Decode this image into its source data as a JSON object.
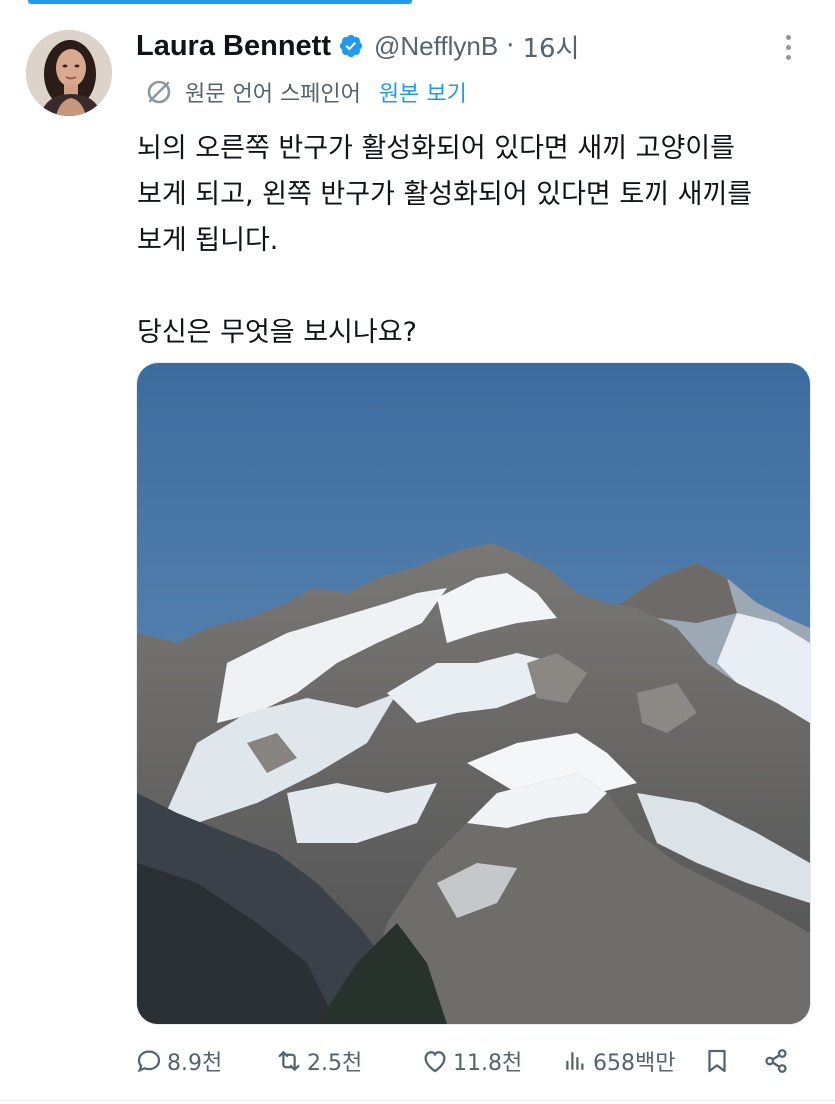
{
  "tweet": {
    "author": {
      "name": "Laura Bennett",
      "handle": "@NefflynB",
      "separator": "·",
      "time": "16시",
      "verified": true
    },
    "translation": {
      "icon": "translate-icon",
      "label": "원문 언어 스페인어",
      "show_original": "원본 보기"
    },
    "text": "뇌의 오른쪽 반구가 활성화되어 있다면 새끼 고양이를\n보게 되고, 왼쪽 반구가 활성화되어 있다면 토끼 새끼를\n보게 됩니다.\n\n당신은 무엇을 보시나요?",
    "media": {
      "type": "image",
      "description_icon": "mountain-photo"
    },
    "actions": {
      "replies": "8.9천",
      "retweets": "2.5천",
      "likes": "11.8천",
      "views": "658백만"
    }
  },
  "colors": {
    "accent": "#1d9bf0",
    "text_primary": "#0f1419",
    "text_secondary": "#536471"
  }
}
